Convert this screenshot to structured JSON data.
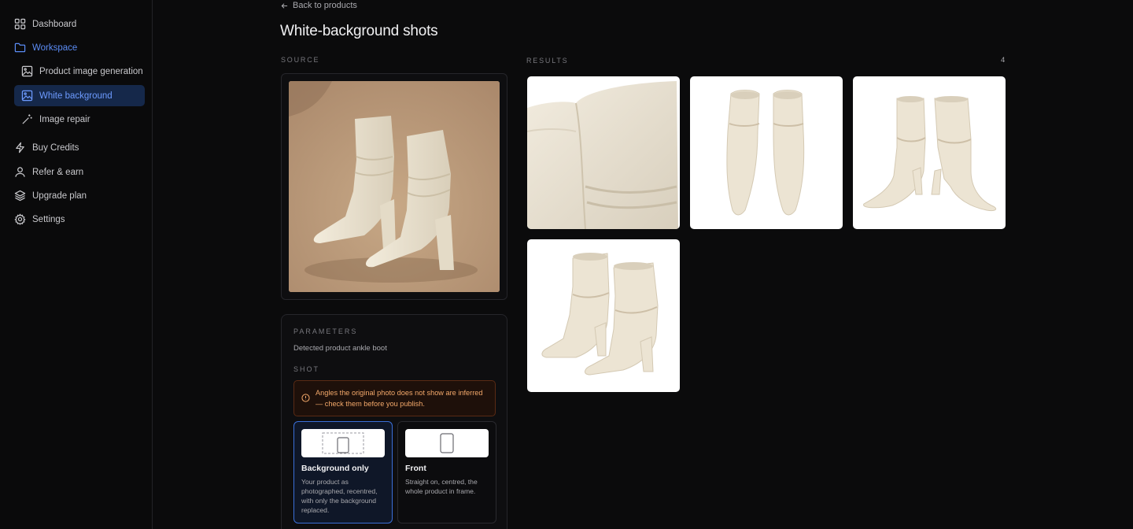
{
  "sidebar": {
    "items": [
      {
        "label": "Dashboard",
        "icon": "grid-icon"
      },
      {
        "label": "Workspace",
        "icon": "folder-icon"
      },
      {
        "label": "Product image generation",
        "icon": "image-icon"
      },
      {
        "label": "White background",
        "icon": "image-icon"
      },
      {
        "label": "Image repair",
        "icon": "magic-wand-icon"
      },
      {
        "label": "Buy Credits",
        "icon": "lightning-icon"
      },
      {
        "label": "Refer & earn",
        "icon": "user-icon"
      },
      {
        "label": "Upgrade plan",
        "icon": "layers-icon"
      },
      {
        "label": "Settings",
        "icon": "gear-icon"
      }
    ]
  },
  "header": {
    "back_label": "Back to products",
    "title": "White-background shots"
  },
  "source": {
    "label": "SOURCE"
  },
  "results": {
    "label": "RESULTS",
    "count": "4"
  },
  "params": {
    "title": "PARAMETERS",
    "detected": "Detected product ankle boot",
    "shot_label": "SHOT",
    "warning": "Angles the original photo does not show are inferred — check them before you publish.",
    "options": [
      {
        "title": "Background only",
        "desc": "Your product as photographed, recentred, with only the background replaced.",
        "selected": true
      },
      {
        "title": "Front",
        "desc": "Straight on, centred, the whole product in frame.",
        "selected": false
      }
    ]
  },
  "colors": {
    "accent": "#6d9bff",
    "warning": "#f3a86a",
    "boot": "#ede6d6"
  }
}
